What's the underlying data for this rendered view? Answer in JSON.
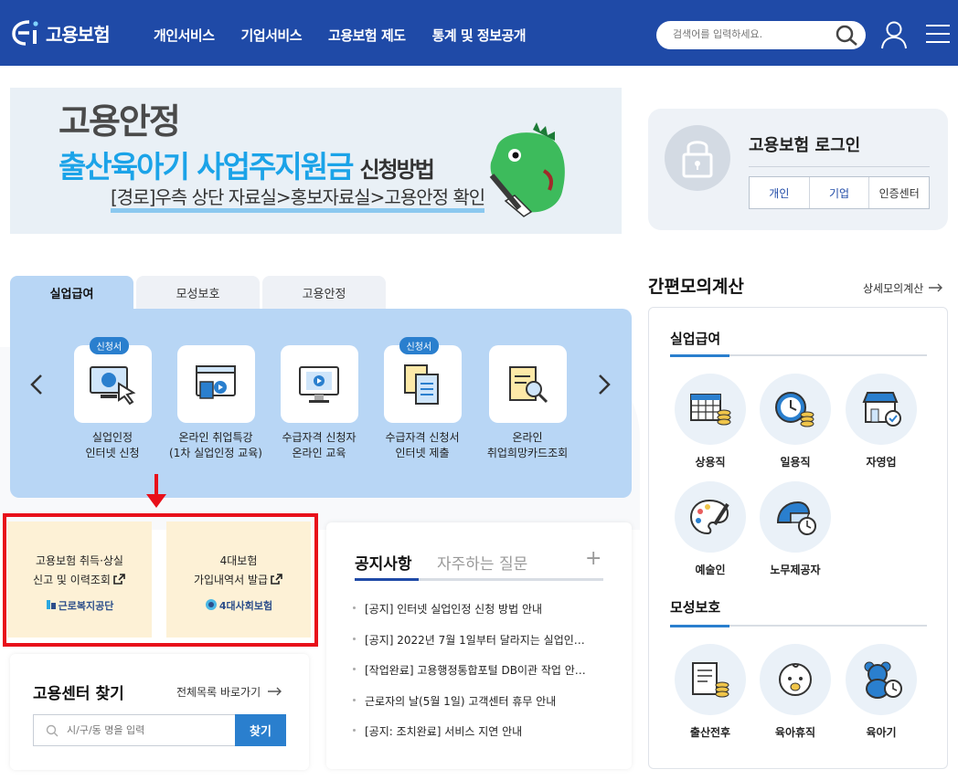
{
  "header": {
    "logo_text": "고용보험",
    "nav": [
      "개인서비스",
      "기업서비스",
      "고용보험 제도",
      "통계 및 정보공개"
    ],
    "search_placeholder": "검색어를 입력하세요."
  },
  "banner": {
    "line1": "고용안정",
    "line2": "출산육아기 사업주지원금",
    "line2_suffix": "신청방법",
    "line3": "[경로]우측 상단 자료실>홍보자료실>고용안정 확인"
  },
  "login": {
    "title": "고용보험 로그인",
    "buttons": [
      "개인",
      "기업",
      "인증센터"
    ]
  },
  "tabs": [
    "실업급여",
    "모성보호",
    "고용안정"
  ],
  "services": [
    {
      "label": "실업인정\n인터넷 신청",
      "badge": "신청서"
    },
    {
      "label": "온라인 취업특강\n(1차 실업인정 교육)",
      "badge": ""
    },
    {
      "label": "수급자격 신청자\n온라인 교육",
      "badge": ""
    },
    {
      "label": "수급자격 신청서\n인터넷 제출",
      "badge": "신청서"
    },
    {
      "label": "온라인\n취업희망카드조회",
      "badge": ""
    }
  ],
  "cards": [
    {
      "title": "고용보험 취득·상실\n신고 및 이력조회",
      "org": "근로복지공단"
    },
    {
      "title": "4대보험\n가입내역서 발급",
      "org": "4대사회보험"
    }
  ],
  "notice": {
    "tab_active": "공지사항",
    "tab_inactive": "자주하는 질문",
    "plus": "+",
    "items": [
      "[공지] 인터넷 실업인정 신청 방법 안내",
      "[공지] 2022년 7월 1일부터 달라지는 실업인…",
      "[작업완료] 고용행정통합포털 DB이관 작업 안…",
      "근로자의 날(5월 1일) 고객센터 휴무 안내",
      "[공지: 조치완료] 서비스 지연 안내"
    ]
  },
  "center": {
    "title": "고용센터 찾기",
    "link": "전체목록 바로가기",
    "placeholder": "시/구/동 명을 입력",
    "button": "찾기"
  },
  "calc": {
    "title": "간편모의계산",
    "link": "상세모의계산",
    "section1": "실업급여",
    "section1_items": [
      "상용직",
      "일용직",
      "자영업",
      "예술인",
      "노무제공자"
    ],
    "section2": "모성보호",
    "section2_items": [
      "출산전후",
      "육아휴직",
      "육아기"
    ]
  }
}
